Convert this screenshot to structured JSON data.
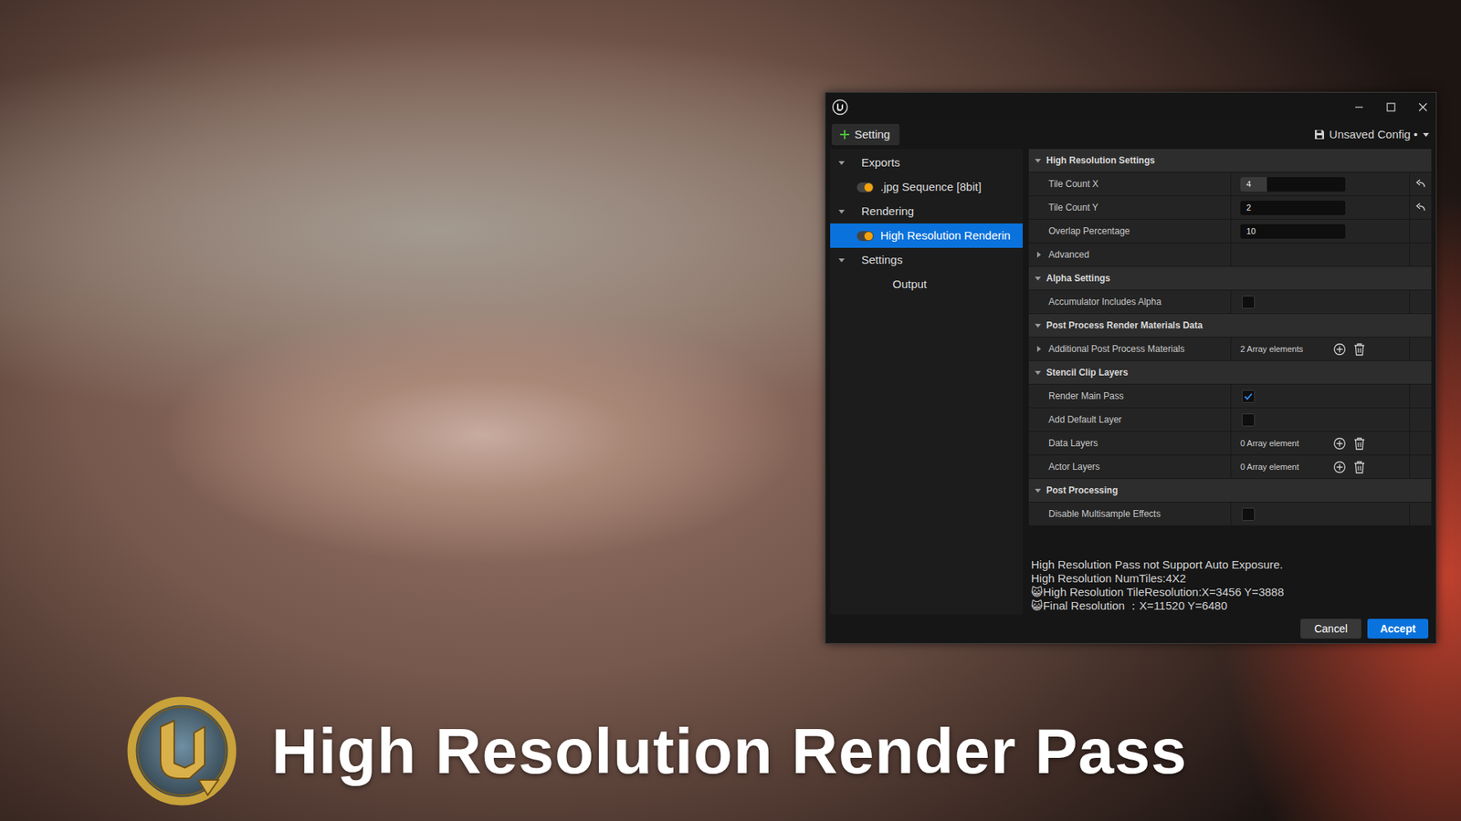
{
  "toolbar": {
    "add_label": "Setting",
    "config_label": "Unsaved Config •"
  },
  "tree": [
    {
      "label": "Exports",
      "kind": "group",
      "expanded": true
    },
    {
      "label": ".jpg Sequence [8bit]",
      "kind": "item",
      "enabled": true,
      "selected": false
    },
    {
      "label": "Rendering",
      "kind": "group",
      "expanded": true
    },
    {
      "label": "High Resolution Renderin",
      "kind": "item",
      "enabled": true,
      "selected": true
    },
    {
      "label": "Settings",
      "kind": "group",
      "expanded": true
    },
    {
      "label": "Output",
      "kind": "leaf",
      "selected": false
    }
  ],
  "details": [
    {
      "header": "High Resolution Settings",
      "expanded": true,
      "rows": [
        {
          "kind": "number",
          "name": "Tile Count X",
          "value": "4",
          "level": 0.25,
          "resettable": true
        },
        {
          "kind": "number",
          "name": "Tile Count Y",
          "value": "2",
          "level": 0,
          "resettable": true
        },
        {
          "kind": "number",
          "name": "Overlap Percentage",
          "value": "10",
          "level": 0,
          "resettable": false
        },
        {
          "kind": "group",
          "name": "Advanced",
          "expanded": false
        }
      ]
    },
    {
      "header": "Alpha Settings",
      "expanded": true,
      "rows": [
        {
          "kind": "checkbox",
          "name": "Accumulator Includes Alpha",
          "checked": false
        }
      ]
    },
    {
      "header": "Post Process Render Materials Data",
      "expanded": true,
      "rows": [
        {
          "kind": "array",
          "name": "Additional Post Process Materials",
          "value": "2 Array elements",
          "expanded": false
        }
      ]
    },
    {
      "header": "Stencil Clip Layers",
      "expanded": true,
      "rows": [
        {
          "kind": "checkbox",
          "name": "Render Main Pass",
          "checked": true
        },
        {
          "kind": "checkbox",
          "name": "Add Default Layer",
          "checked": false
        },
        {
          "kind": "array",
          "name": "Data Layers",
          "value": "0 Array element"
        },
        {
          "kind": "array",
          "name": "Actor Layers",
          "value": "0 Array element"
        }
      ]
    },
    {
      "header": "Post Processing",
      "expanded": true,
      "rows": [
        {
          "kind": "checkbox",
          "name": "Disable Multisample Effects",
          "checked": false
        }
      ]
    }
  ],
  "log": [
    "High Resolution Pass not Support Auto Exposure.",
    "High Resolution NumTiles:4X2",
    "😺High Resolution TileResolution:X=3456 Y=3888",
    "😺Final Resolution ：X=11520 Y=6480"
  ],
  "buttons": [
    {
      "label": "Cancel",
      "primary": false
    },
    {
      "label": "Accept",
      "primary": true
    }
  ],
  "banner": {
    "title": "High Resolution Render Pass"
  }
}
